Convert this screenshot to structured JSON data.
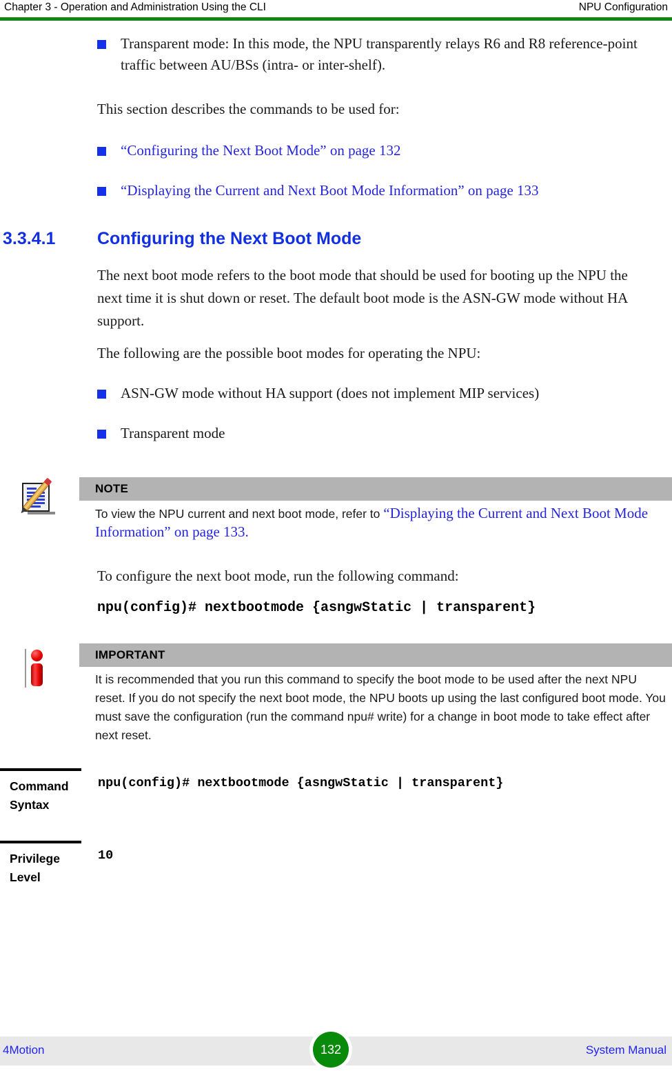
{
  "header": {
    "left": "Chapter 3 - Operation and Administration Using the CLI",
    "right": "NPU Configuration",
    "rule_color": "#118811"
  },
  "body": {
    "intro_bullet": "Transparent mode: In this mode, the NPU transparently relays R6 and R8 reference-point traffic between AU/BSs (intra- or inter-shelf).",
    "intro_para": "This section describes the commands to be used for:",
    "xref_bullets": [
      "“Configuring the Next Boot Mode” on page 132",
      "“Displaying the Current and Next Boot Mode Information” on page 133"
    ]
  },
  "section": {
    "number": "3.3.4.1",
    "title": "Configuring the Next Boot Mode",
    "paragraphs": [
      "The next boot mode refers to the boot mode that should be used for booting up the NPU the next time it is shut down or reset. The default boot mode is the ASN-GW mode without HA support.",
      "The following are the possible boot modes for operating the NPU:"
    ],
    "mode_bullets": [
      "ASN-GW mode without HA support (does not implement MIP services)",
      "Transparent mode"
    ],
    "run_command_intro": "To configure the next boot mode, run the following command:",
    "command": "npu(config)# nextbootmode {asngwStatic | transparent}"
  },
  "note": {
    "title": "NOTE",
    "icon": "notepad-pencil-icon",
    "text_plain": "To view the NPU current and next boot mode, refer to ",
    "text_link": "“Displaying the Current and Next Boot Mode Information” on page 133",
    "text_tail": ".",
    "bar_color": "#b3b3b3"
  },
  "important": {
    "title": "IMPORTANT",
    "icon": "red-info-icon",
    "text": "It is recommended that you run this command to specify the boot mode to be used after the next NPU reset. If you do not specify the next boot mode, the NPU boots up using the last configured boot mode. You must save the configuration (run the command npu# write)  for a change in boot mode to take effect after next reset.",
    "bar_color": "#b3b3b3"
  },
  "command_table": {
    "rows": [
      {
        "label": "Command Syntax",
        "value": "npu(config)# nextbootmode {asngwStatic | transparent}"
      },
      {
        "label": "Privilege Level",
        "value": "10"
      }
    ]
  },
  "footer": {
    "left": "4Motion",
    "page_number": "132",
    "right": "System Manual",
    "badge_color": "#0a8a0a"
  }
}
